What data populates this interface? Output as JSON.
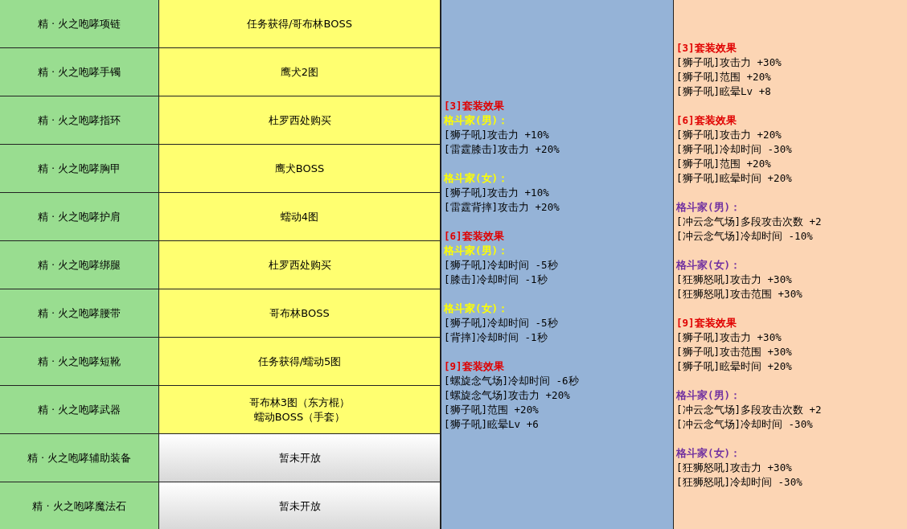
{
  "table": {
    "rows": [
      {
        "item": "精 · 火之咆哮项链",
        "source": [
          "任务获得/哥布林BOSS"
        ],
        "kind": "normal"
      },
      {
        "item": "精 · 火之咆哮手镯",
        "source": [
          "鹰犬2图"
        ],
        "kind": "normal"
      },
      {
        "item": "精 · 火之咆哮指环",
        "source": [
          "杜罗西处购买"
        ],
        "kind": "normal"
      },
      {
        "item": "精 · 火之咆哮胸甲",
        "source": [
          "鹰犬BOSS"
        ],
        "kind": "normal"
      },
      {
        "item": "精 · 火之咆哮护肩",
        "source": [
          "蠕动4图"
        ],
        "kind": "normal"
      },
      {
        "item": "精 · 火之咆哮绑腿",
        "source": [
          "杜罗西处购买"
        ],
        "kind": "normal"
      },
      {
        "item": "精 · 火之咆哮腰带",
        "source": [
          "哥布林BOSS"
        ],
        "kind": "normal"
      },
      {
        "item": "精 · 火之咆哮短靴",
        "source": [
          "任务获得/蠕动5图"
        ],
        "kind": "normal"
      },
      {
        "item": "精 · 火之咆哮武器",
        "source": [
          "哥布林3图（东方棍）",
          "蠕动BOSS（手套）"
        ],
        "kind": "normal"
      },
      {
        "item": "精 · 火之咆哮辅助装备",
        "source": [
          "暂未开放"
        ],
        "kind": "unreleased"
      },
      {
        "item": "精 · 火之咆哮魔法石",
        "source": [
          "暂未开放"
        ],
        "kind": "unreleased"
      }
    ],
    "set_effects": [
      {
        "groups": [
          {
            "lines": [
              {
                "kind": "heading",
                "text": "[3]套装效果"
              },
              {
                "kind": "class",
                "text": "格斗家(男)："
              },
              {
                "kind": "stat",
                "text": "[狮子吼]攻击力 +10%"
              },
              {
                "kind": "stat",
                "text": "[雷霆膝击]攻击力 +20%"
              }
            ]
          },
          {
            "lines": [
              {
                "kind": "class",
                "text": "格斗家(女)："
              },
              {
                "kind": "stat",
                "text": "[狮子吼]攻击力 +10%"
              },
              {
                "kind": "stat",
                "text": "[雷霆背摔]攻击力 +20%"
              }
            ]
          },
          {
            "lines": [
              {
                "kind": "heading",
                "text": "[6]套装效果"
              },
              {
                "kind": "class",
                "text": "格斗家(男)："
              },
              {
                "kind": "stat",
                "text": "[狮子吼]冷却时间 -5秒"
              },
              {
                "kind": "stat",
                "text": "[膝击]冷却时间 -1秒"
              }
            ]
          },
          {
            "lines": [
              {
                "kind": "class",
                "text": "格斗家(女)："
              },
              {
                "kind": "stat",
                "text": "[狮子吼]冷却时间 -5秒"
              },
              {
                "kind": "stat",
                "text": "[背摔]冷却时间 -1秒"
              }
            ]
          },
          {
            "lines": [
              {
                "kind": "heading",
                "text": "[9]套装效果"
              },
              {
                "kind": "stat",
                "text": "[螺旋念气场]冷却时间 -6秒"
              },
              {
                "kind": "stat",
                "text": "[螺旋念气场]攻击力 +20%"
              },
              {
                "kind": "stat",
                "text": "[狮子吼]范围 +20%"
              },
              {
                "kind": "stat",
                "text": "[狮子吼]眩晕Lv +6"
              }
            ]
          }
        ]
      },
      {
        "groups": [
          {
            "lines": [
              {
                "kind": "heading",
                "text": "[3]套装效果"
              },
              {
                "kind": "stat",
                "text": "[狮子吼]攻击力 +30%"
              },
              {
                "kind": "stat",
                "text": "[狮子吼]范围 +20%"
              },
              {
                "kind": "stat",
                "text": "[狮子吼]眩晕Lv +8"
              }
            ]
          },
          {
            "lines": [
              {
                "kind": "heading",
                "text": "[6]套装效果"
              },
              {
                "kind": "stat",
                "text": "[狮子吼]攻击力 +20%"
              },
              {
                "kind": "stat",
                "text": "[狮子吼]冷却时间 -30%"
              },
              {
                "kind": "stat",
                "text": "[狮子吼]范围 +20%"
              },
              {
                "kind": "stat",
                "text": "[狮子吼]眩晕时间 +20%"
              }
            ]
          },
          {
            "lines": [
              {
                "kind": "class",
                "text": "格斗家(男)："
              },
              {
                "kind": "stat",
                "text": "[冲云念气场]多段攻击次数 +2"
              },
              {
                "kind": "stat",
                "text": "[冲云念气场]冷却时间 -10%"
              }
            ]
          },
          {
            "lines": [
              {
                "kind": "class",
                "text": "格斗家(女)："
              },
              {
                "kind": "stat",
                "text": "[狂狮怒吼]攻击力 +30%"
              },
              {
                "kind": "stat",
                "text": "[狂狮怒吼]攻击范围 +30%"
              }
            ]
          },
          {
            "lines": [
              {
                "kind": "heading",
                "text": "[9]套装效果"
              },
              {
                "kind": "stat",
                "text": "[狮子吼]攻击力 +30%"
              },
              {
                "kind": "stat",
                "text": "[狮子吼]攻击范围 +30%"
              },
              {
                "kind": "stat",
                "text": "[狮子吼]眩晕时间 +20%"
              }
            ]
          },
          {
            "lines": [
              {
                "kind": "class",
                "text": "格斗家(男)："
              },
              {
                "kind": "stat",
                "text": "[冲云念气场]多段攻击次数 +2"
              },
              {
                "kind": "stat",
                "text": "[冲云念气场]冷却时间 -30%"
              }
            ]
          },
          {
            "lines": [
              {
                "kind": "class",
                "text": "格斗家(女)："
              },
              {
                "kind": "stat",
                "text": "[狂狮怒吼]攻击力 +30%"
              },
              {
                "kind": "stat",
                "text": "[狂狮怒吼]冷却时间 -30%"
              }
            ]
          }
        ]
      }
    ]
  }
}
